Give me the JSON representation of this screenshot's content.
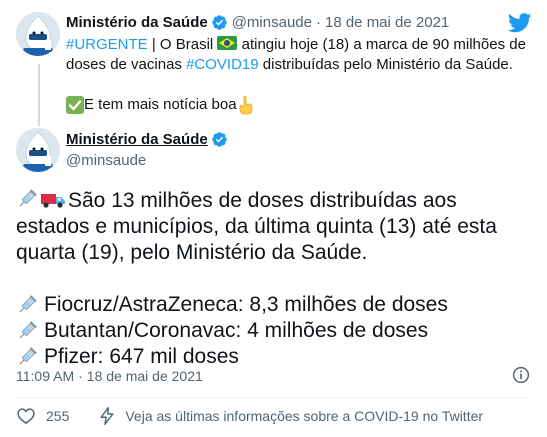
{
  "parent": {
    "name": "Ministério da Saúde",
    "handle": "@minsaude",
    "separator": "·",
    "date": "18 de mai de 2021",
    "body_hashtag1": "#URGENTE",
    "body_part1": " | O Brasil ",
    "body_part2": " atingiu hoje (18) a marca de 90 milhões de doses de vacinas ",
    "body_hashtag2": "#COVID19",
    "body_part3": " distribuídas pelo Ministério da Saúde.",
    "line2_text": " E tem mais notícia boa",
    "icons": [
      "avatar",
      "verified-icon",
      "brazil-flag-icon",
      "check-mark-icon",
      "pointing-down-icon"
    ]
  },
  "twitter_logo": "twitter-bird-icon",
  "main": {
    "name": "Ministério da Saúde",
    "handle": "@minsaude",
    "line1": "São 13 milhões de doses distribuídas aos estados e municípios, da última quinta (13) até esta quarta (19), pelo Ministério da Saúde.",
    "items": [
      "Fiocruz/AstraZeneca: 8,3 milhões de doses",
      "Butantan/Coronavac: 4 milhões de doses",
      "Pfizer: 647 mil doses"
    ],
    "time": "11:09 AM",
    "separator": "·",
    "date": "18 de mai de 2021",
    "icons": [
      "syringe-icon",
      "truck-icon",
      "info-icon"
    ]
  },
  "actions": {
    "likes": "255",
    "cta": "Veja as últimas informações sobre a COVID-19 no Twitter",
    "icons": [
      "heart-icon",
      "lightning-icon"
    ]
  },
  "colors": {
    "link": "#1d9bf0",
    "text": "#0f1419",
    "muted": "#536471",
    "verified": "#1d9bf0"
  }
}
